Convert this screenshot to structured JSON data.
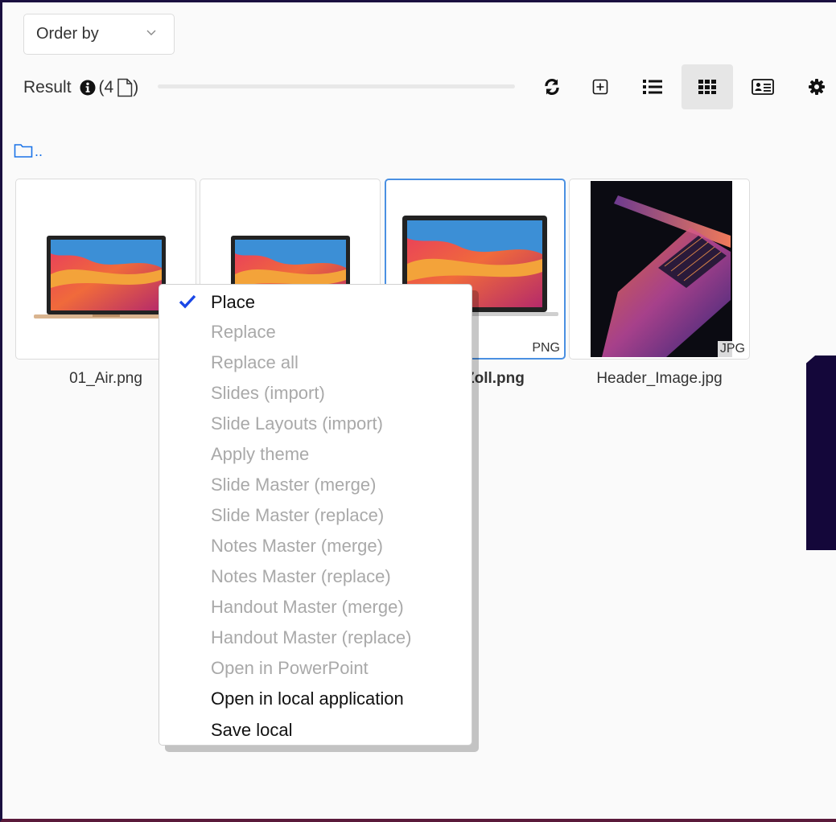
{
  "order_by": {
    "label": "Order by"
  },
  "result": {
    "label": "Result",
    "open_paren": "(4",
    "close_paren": ")"
  },
  "toolbar": {
    "items": [
      {
        "name": "refresh-icon"
      },
      {
        "name": "add-icon"
      },
      {
        "name": "list-view-icon"
      },
      {
        "name": "grid-view-icon",
        "active": true
      },
      {
        "name": "detail-view-icon"
      },
      {
        "name": "settings-icon"
      }
    ]
  },
  "parent_folder": {
    "label": ".."
  },
  "files": [
    {
      "name": "01_Air.png",
      "type": "PNG",
      "selected": false
    },
    {
      "name": "",
      "type": "",
      "selected": false
    },
    {
      "name": "Zoll.png",
      "type": "PNG",
      "selected": true
    },
    {
      "name": "Header_Image.jpg",
      "type": "JPG",
      "selected": false
    }
  ],
  "context_menu": {
    "items": [
      {
        "label": "Place",
        "checked": true,
        "enabled": true
      },
      {
        "label": "Replace",
        "enabled": false
      },
      {
        "label": "Replace all",
        "enabled": false
      },
      {
        "label": "Slides (import)",
        "enabled": false
      },
      {
        "label": "Slide Layouts (import)",
        "enabled": false
      },
      {
        "label": "Apply theme",
        "enabled": false
      },
      {
        "label": "Slide Master (merge)",
        "enabled": false
      },
      {
        "label": "Slide Master (replace)",
        "enabled": false
      },
      {
        "label": "Notes Master (merge)",
        "enabled": false
      },
      {
        "label": "Notes Master (replace)",
        "enabled": false
      },
      {
        "label": "Handout Master (merge)",
        "enabled": false
      },
      {
        "label": "Handout Master (replace)",
        "enabled": false
      },
      {
        "label": "Open in PowerPoint",
        "enabled": false
      },
      {
        "label": "Open in local application",
        "enabled": true
      },
      {
        "label": "Save local",
        "enabled": true
      }
    ]
  },
  "colors": {
    "accent": "#1a73e8",
    "check": "#1a47e6",
    "selected_border": "#4a90e2",
    "disabled_text": "#a9a9a9",
    "frame": "#1a1040"
  }
}
